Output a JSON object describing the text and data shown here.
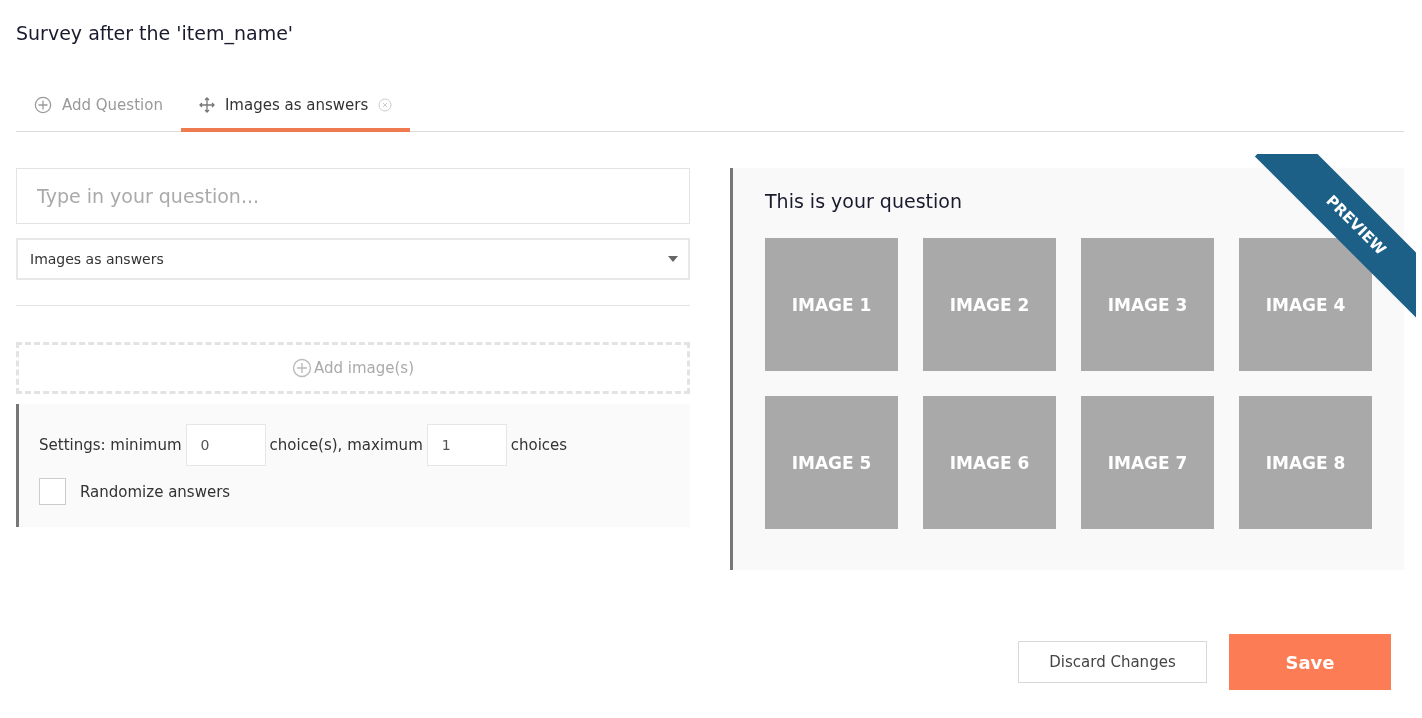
{
  "page_title": "Survey after the 'item_name'",
  "tabs": [
    {
      "label": "Add Question",
      "selected": false,
      "closable": false
    },
    {
      "label": "Images as answers",
      "selected": true,
      "closable": true
    }
  ],
  "question_field": {
    "placeholder": "Type in your question..."
  },
  "type_select": {
    "value": "Images as answers"
  },
  "add_images": {
    "label": "Add image(s)"
  },
  "settings": {
    "prefix": "Settings: minimum",
    "minimum": "0",
    "middle": "choice(s), maximum",
    "maximum": "1",
    "suffix": "choices",
    "randomize": {
      "label": "Randomize answers",
      "checked": false
    }
  },
  "preview": {
    "question": "This is your question",
    "ribbon": "PREVIEW",
    "images": [
      "IMAGE 1",
      "IMAGE 2",
      "IMAGE 3",
      "IMAGE 4",
      "IMAGE 5",
      "IMAGE 6",
      "IMAGE 7",
      "IMAGE 8"
    ]
  },
  "buttons": [
    {
      "label": "Discard Changes",
      "kind": "secondary"
    },
    {
      "label": "Save",
      "kind": "primary"
    }
  ]
}
